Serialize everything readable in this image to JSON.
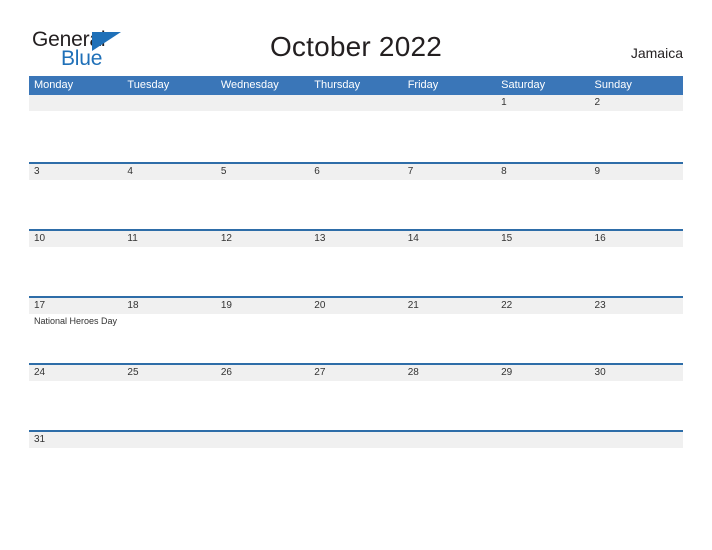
{
  "brand": {
    "name_part1": "General",
    "name_part2": "Blue",
    "triangle_color": "#1f70b8"
  },
  "header": {
    "title": "October 2022",
    "region": "Jamaica"
  },
  "theme": {
    "header_blue": "#3a76b8",
    "row_divider_blue": "#2e6da8",
    "daynum_band_gray": "#f0f0f0",
    "text_dark": "#231f20"
  },
  "calendar": {
    "weekday_headers": [
      "Monday",
      "Tuesday",
      "Wednesday",
      "Thursday",
      "Friday",
      "Saturday",
      "Sunday"
    ],
    "weeks": [
      {
        "days": [
          {
            "num": "",
            "event": ""
          },
          {
            "num": "",
            "event": ""
          },
          {
            "num": "",
            "event": ""
          },
          {
            "num": "",
            "event": ""
          },
          {
            "num": "",
            "event": ""
          },
          {
            "num": "1",
            "event": ""
          },
          {
            "num": "2",
            "event": ""
          }
        ]
      },
      {
        "days": [
          {
            "num": "3",
            "event": ""
          },
          {
            "num": "4",
            "event": ""
          },
          {
            "num": "5",
            "event": ""
          },
          {
            "num": "6",
            "event": ""
          },
          {
            "num": "7",
            "event": ""
          },
          {
            "num": "8",
            "event": ""
          },
          {
            "num": "9",
            "event": ""
          }
        ]
      },
      {
        "days": [
          {
            "num": "10",
            "event": ""
          },
          {
            "num": "11",
            "event": ""
          },
          {
            "num": "12",
            "event": ""
          },
          {
            "num": "13",
            "event": ""
          },
          {
            "num": "14",
            "event": ""
          },
          {
            "num": "15",
            "event": ""
          },
          {
            "num": "16",
            "event": ""
          }
        ]
      },
      {
        "days": [
          {
            "num": "17",
            "event": "National Heroes Day"
          },
          {
            "num": "18",
            "event": ""
          },
          {
            "num": "19",
            "event": ""
          },
          {
            "num": "20",
            "event": ""
          },
          {
            "num": "21",
            "event": ""
          },
          {
            "num": "22",
            "event": ""
          },
          {
            "num": "23",
            "event": ""
          }
        ]
      },
      {
        "days": [
          {
            "num": "24",
            "event": ""
          },
          {
            "num": "25",
            "event": ""
          },
          {
            "num": "26",
            "event": ""
          },
          {
            "num": "27",
            "event": ""
          },
          {
            "num": "28",
            "event": ""
          },
          {
            "num": "29",
            "event": ""
          },
          {
            "num": "30",
            "event": ""
          }
        ]
      },
      {
        "days": [
          {
            "num": "31",
            "event": ""
          },
          {
            "num": "",
            "event": ""
          },
          {
            "num": "",
            "event": ""
          },
          {
            "num": "",
            "event": ""
          },
          {
            "num": "",
            "event": ""
          },
          {
            "num": "",
            "event": ""
          },
          {
            "num": "",
            "event": ""
          }
        ]
      }
    ]
  }
}
